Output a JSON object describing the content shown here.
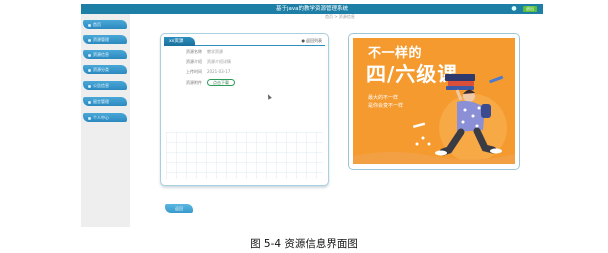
{
  "header": {
    "title": "基于java的教学资源管理系统",
    "logout_label": "退出"
  },
  "breadcrumb": "首页 > 资源信息",
  "sidebar": {
    "items": [
      {
        "label": "首页"
      },
      {
        "label": "资源管理"
      },
      {
        "label": "资源信息"
      },
      {
        "label": "资源分类"
      },
      {
        "label": "公告信息"
      },
      {
        "label": "留言管理"
      },
      {
        "label": "个人中心"
      }
    ]
  },
  "detail": {
    "tab_label": "xx资源",
    "back_label": "返回列表",
    "rows": [
      {
        "label": "资源名称",
        "value": "教学资源"
      },
      {
        "label": "资源介绍",
        "value": "资源介绍详情"
      },
      {
        "label": "上传时间",
        "value": "2021-03-17"
      },
      {
        "label": "资源附件",
        "button": "点击下载"
      }
    ]
  },
  "poster": {
    "line1": "不一样的",
    "line2": "四/六级课",
    "sub1": "最大的不一样",
    "sub2": "是你会变不一样",
    "background": "#f59a2e"
  },
  "bottom_button": "返回",
  "caption": "图 5-4 资源信息界面图",
  "colors": {
    "primary": "#1e7fa6",
    "accent_green": "#5bbf3c"
  }
}
